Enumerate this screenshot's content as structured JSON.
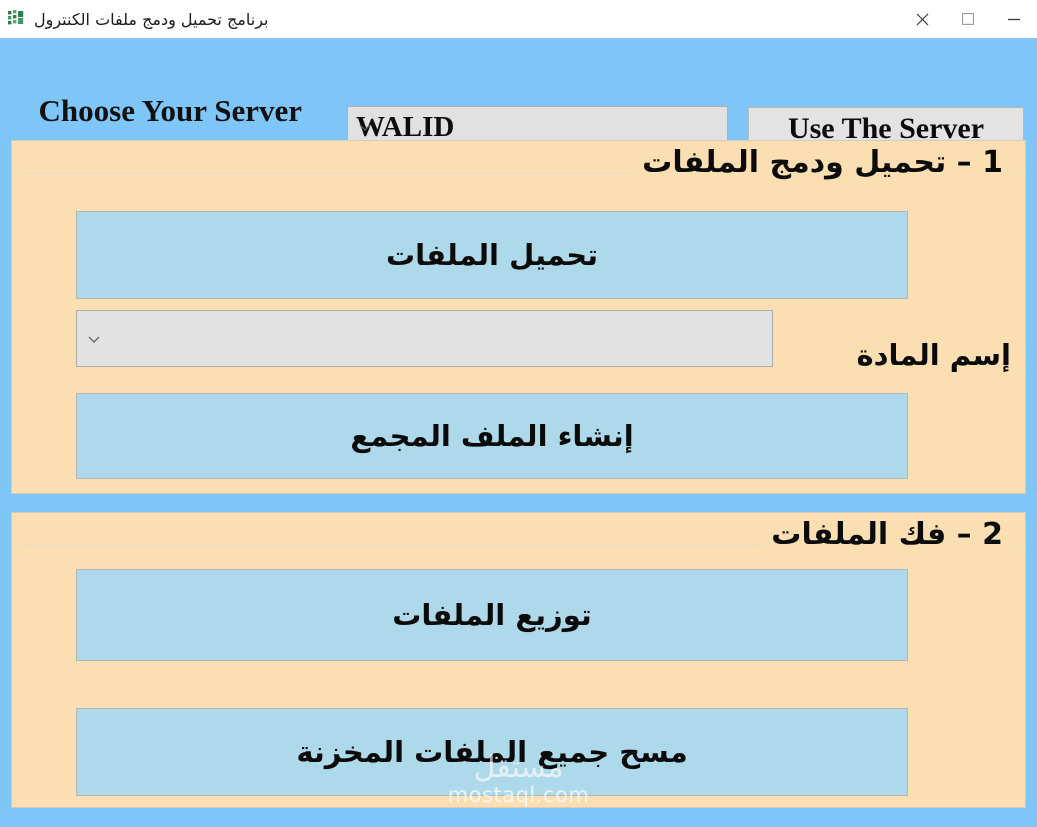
{
  "window": {
    "title": "برنامج تحميل ودمج ملفات الكنترول",
    "app_icon": "excel-app-icon",
    "controls": {
      "close": "close-icon",
      "maximize": "maximize-icon",
      "minimize": "minimize-icon"
    }
  },
  "colors": {
    "window_background": "#7ec6f7",
    "panel_background": "#fbdfb2",
    "action_button": "#aed9ea",
    "field_background": "#e1e1e1",
    "titlebar_background": "#ffffff",
    "text": "#0a0a0a"
  },
  "server_bar": {
    "choose_label": "Choose Your Server",
    "server_select": {
      "value": "WALID",
      "placeholder": "",
      "chevron": "chevron-down-icon"
    },
    "use_server_button": "Use The Server"
  },
  "groups": [
    {
      "title": "1 – تحميل ودمج الملفات",
      "upload_button": "تحميل الملفات",
      "material_label": "إسم المادة",
      "material_select": {
        "value": "",
        "placeholder": "",
        "chevron": "chevron-down-icon"
      },
      "create_button": "إنشاء الملف المجمع"
    },
    {
      "title": "2 – فك الملفات",
      "distribute_button": "توزيع الملفات",
      "clear_button": "مسح جميع الملفات المخزنة"
    }
  ],
  "watermark": {
    "arabic": "مستقل",
    "latin": "mostaql.com"
  }
}
